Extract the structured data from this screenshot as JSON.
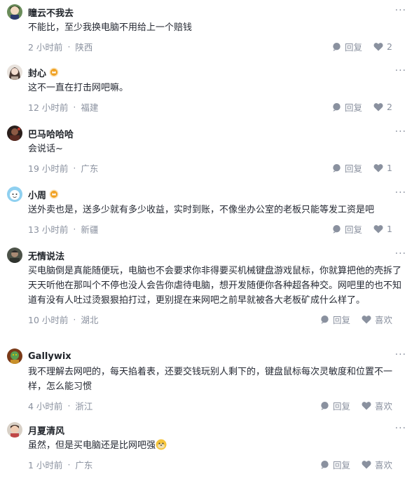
{
  "comments": [
    {
      "username": "瞳云不我去",
      "badge": false,
      "text": "不能比，至少我换电脑不用给上一个赔钱",
      "time": "2 小时前",
      "location": "陕西",
      "reply_label": "回复",
      "like_label": "2",
      "avatar_icon": "anime-avatar"
    },
    {
      "username": "封心",
      "badge": true,
      "text": "这不一直在打击网吧嘛。",
      "time": "12 小时前",
      "location": "福建",
      "reply_label": "回复",
      "like_label": "2",
      "avatar_icon": "girl-avatar"
    },
    {
      "username": "巴马哈哈哈",
      "badge": false,
      "text": "会说话~",
      "time": "19 小时前",
      "location": "广东",
      "reply_label": "回复",
      "like_label": "1",
      "avatar_icon": "dark-photo-avatar"
    },
    {
      "username": "小周",
      "badge": true,
      "text": "送外卖也是，送多少就有多少收益，实时到账，不像坐办公室的老板只能等发工资是吧",
      "time": "13 小时前",
      "location": "新疆",
      "reply_label": "回复",
      "like_label": "1",
      "avatar_icon": "cartoon-avatar"
    },
    {
      "username": "无情说法",
      "badge": false,
      "text": "买电脑倒是真能随便玩，电脑也不会要求你非得要买机械键盘游戏鼠标，你就算把他的壳拆了天天听他在那叫个不停也没人会告你虐待电脑，想开发随便你各种超各种交。网吧里的也不知道有没有人吐过烫狠狠拍打过，更别提在来网吧之前早就被各大老板矿成什么样了。",
      "time": "10 小时前",
      "location": "湖北",
      "reply_label": "回复",
      "like_label": "喜欢",
      "avatar_icon": "man-photo-avatar"
    },
    {
      "username": "Gallywix",
      "badge": false,
      "text": "我不理解去网吧的，每天掐着表，还要交钱玩别人剩下的，键盘鼠标每次灵敏度和位置不一样，怎么能习惯",
      "time": "4 小时前",
      "location": "浙江",
      "reply_label": "回复",
      "like_label": "喜欢",
      "avatar_icon": "game-character-avatar"
    },
    {
      "username": "月夏清风",
      "badge": false,
      "text": "虽然，但是买电脑还是比网吧强",
      "text_emoji": "doge-emoji",
      "time": "1 小时前",
      "location": "广东",
      "reply_label": "回复",
      "like_label": "喜欢",
      "avatar_icon": "child-photo-avatar"
    }
  ],
  "more_icon": "more-dots-icon",
  "reply_icon": "reply-bubble-icon",
  "like_icon": "heart-icon",
  "badge_icon": "level-badge-icon",
  "colors": {
    "muted": "#8a919f",
    "text": "#252933",
    "name": "#1f2329",
    "badge": "#f0a020"
  }
}
